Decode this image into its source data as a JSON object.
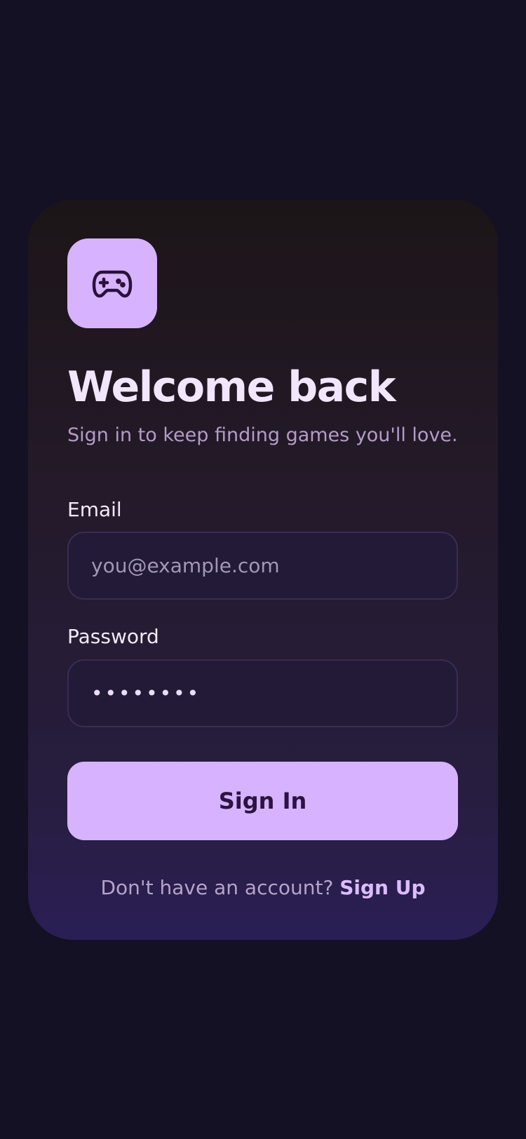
{
  "logo": {
    "icon": "gamepad-icon",
    "background": "#d7b3ff"
  },
  "title": "Welcome back",
  "subtitle": "Sign in to keep finding games you'll love.",
  "form": {
    "email_label": "Email",
    "email_placeholder": "you@example.com",
    "email_value": "",
    "password_label": "Password",
    "password_value": "••••••••"
  },
  "signin_button": "Sign In",
  "footer": {
    "prompt": "Don't have an account?",
    "signup_link": "Sign Up"
  },
  "colors": {
    "background": "#151124",
    "accent": "#d7b3ff",
    "button_text": "#2b1440"
  }
}
